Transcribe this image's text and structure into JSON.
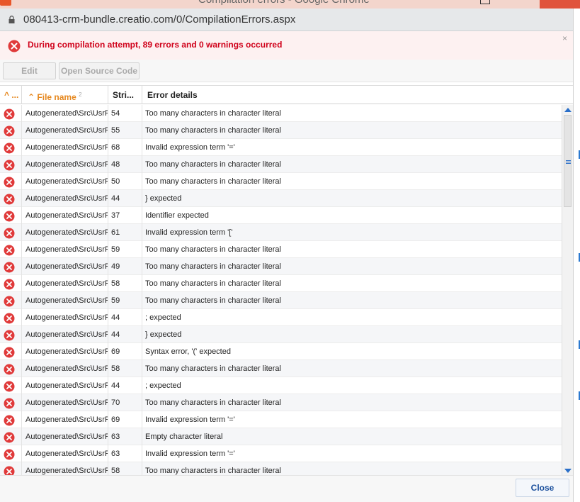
{
  "browser": {
    "window_title": "Compilation errors - Google Chrome",
    "url": "080413-crm-bundle.creatio.com/0/CompilationErrors.aspx"
  },
  "banner": {
    "message": "During compilation attempt, 89 errors and 0 warnings occurred",
    "dismiss_label": "×"
  },
  "toolbar": {
    "edit_label": "Edit",
    "open_source_label": "Open Source Code"
  },
  "grid": {
    "columns": {
      "icon_col": "^ ...",
      "file_name": "File name",
      "file_name_sort_index": "2",
      "line": "Stri...",
      "error_details": "Error details"
    },
    "rows": [
      {
        "file": "Autogenerated\\Src\\UsrF",
        "line": "54",
        "error": "Too many characters in character literal"
      },
      {
        "file": "Autogenerated\\Src\\UsrF",
        "line": "55",
        "error": "Too many characters in character literal"
      },
      {
        "file": "Autogenerated\\Src\\UsrF",
        "line": "68",
        "error": "Invalid expression term '='"
      },
      {
        "file": "Autogenerated\\Src\\UsrF",
        "line": "48",
        "error": "Too many characters in character literal"
      },
      {
        "file": "Autogenerated\\Src\\UsrF",
        "line": "50",
        "error": "Too many characters in character literal"
      },
      {
        "file": "Autogenerated\\Src\\UsrF",
        "line": "44",
        "error": "} expected"
      },
      {
        "file": "Autogenerated\\Src\\UsrF",
        "line": "37",
        "error": "Identifier expected"
      },
      {
        "file": "Autogenerated\\Src\\UsrF",
        "line": "61",
        "error": "Invalid expression term '['"
      },
      {
        "file": "Autogenerated\\Src\\UsrF",
        "line": "59",
        "error": "Too many characters in character literal"
      },
      {
        "file": "Autogenerated\\Src\\UsrF",
        "line": "49",
        "error": "Too many characters in character literal"
      },
      {
        "file": "Autogenerated\\Src\\UsrF",
        "line": "58",
        "error": "Too many characters in character literal"
      },
      {
        "file": "Autogenerated\\Src\\UsrF",
        "line": "59",
        "error": "Too many characters in character literal"
      },
      {
        "file": "Autogenerated\\Src\\UsrF",
        "line": "44",
        "error": "; expected"
      },
      {
        "file": "Autogenerated\\Src\\UsrF",
        "line": "44",
        "error": "} expected"
      },
      {
        "file": "Autogenerated\\Src\\UsrF",
        "line": "69",
        "error": "Syntax error, '(' expected"
      },
      {
        "file": "Autogenerated\\Src\\UsrF",
        "line": "58",
        "error": "Too many characters in character literal"
      },
      {
        "file": "Autogenerated\\Src\\UsrF",
        "line": "44",
        "error": "; expected"
      },
      {
        "file": "Autogenerated\\Src\\UsrF",
        "line": "70",
        "error": "Too many characters in character literal"
      },
      {
        "file": "Autogenerated\\Src\\UsrF",
        "line": "69",
        "error": "Invalid expression term '='"
      },
      {
        "file": "Autogenerated\\Src\\UsrF",
        "line": "63",
        "error": "Empty character literal"
      },
      {
        "file": "Autogenerated\\Src\\UsrF",
        "line": "63",
        "error": "Invalid expression term '='"
      },
      {
        "file": "Autogenerated\\Src\\UsrF",
        "line": "58",
        "error": "Too many characters in character literal"
      }
    ]
  },
  "footer": {
    "close_label": "Close"
  },
  "colors": {
    "error_red": "#d0021b",
    "sort_orange": "#e6881f",
    "link_blue": "#1a4f9c"
  },
  "icons": {
    "row_status": "error-circle-icon",
    "address_lock": "lock-icon"
  }
}
